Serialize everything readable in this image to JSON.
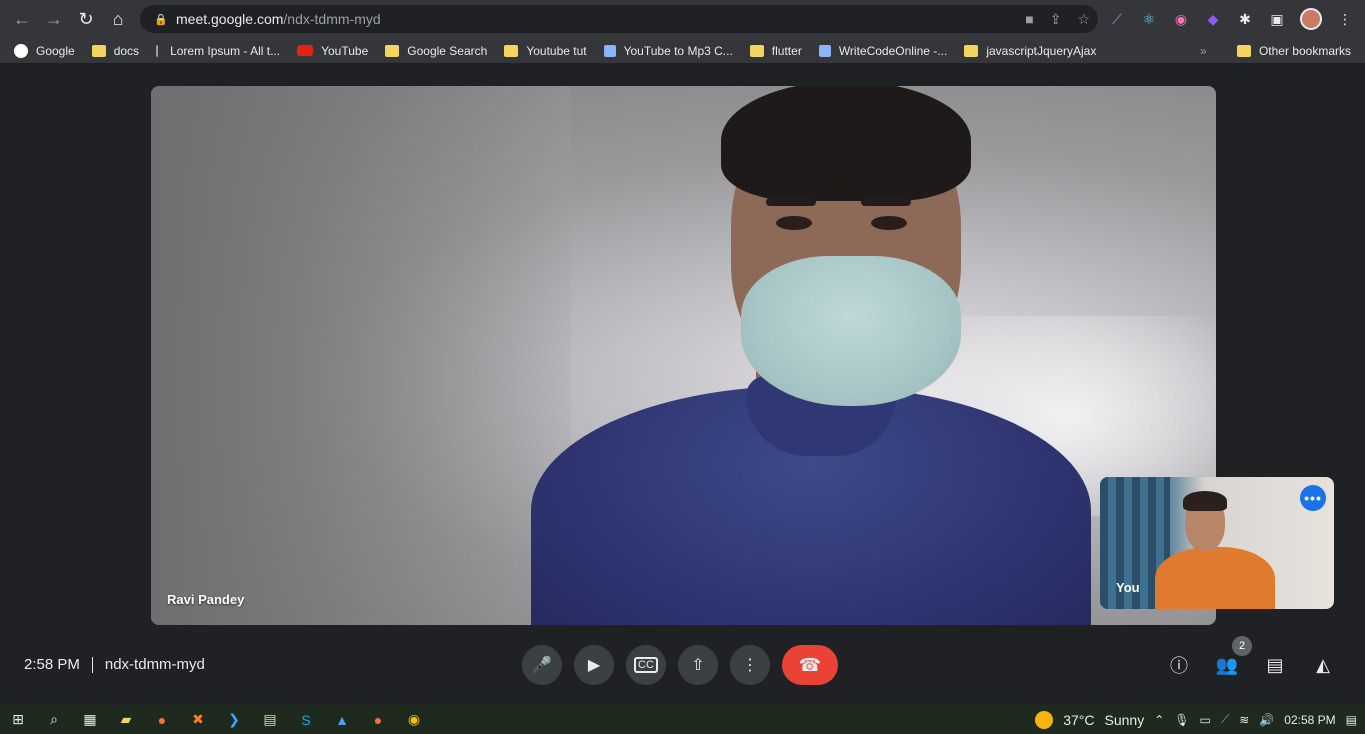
{
  "browser": {
    "url_host": "meet.google.com",
    "url_path": "/ndx-tdmm-myd",
    "bookmarks": [
      {
        "label": "Google",
        "type": "g"
      },
      {
        "label": "docs",
        "type": "folder"
      },
      {
        "label": "Lorem Ipsum - All t...",
        "type": "line"
      },
      {
        "label": "YouTube",
        "type": "yt"
      },
      {
        "label": "Google Search",
        "type": "folder"
      },
      {
        "label": "Youtube tut",
        "type": "folder"
      },
      {
        "label": "YouTube to Mp3 C...",
        "type": "doc"
      },
      {
        "label": "flutter",
        "type": "folder"
      },
      {
        "label": "WriteCodeOnline -...",
        "type": "doc"
      },
      {
        "label": "javascriptJqueryAjax",
        "type": "folder"
      }
    ],
    "overflow": "»",
    "other_bookmarks": "Other bookmarks"
  },
  "meet": {
    "main_participant": "Ravi Pandey",
    "self_label": "You",
    "time": "2:58 PM",
    "meeting_code": "ndx-tdmm-myd",
    "participant_count": "2"
  },
  "icons": {
    "back": "arrow-left-icon",
    "forward": "arrow-right-icon",
    "reload": "reload-icon",
    "home": "home-icon"
  },
  "taskbar": {
    "temperature": "37°C",
    "weather": "Sunny",
    "clock": "02:58 PM"
  }
}
